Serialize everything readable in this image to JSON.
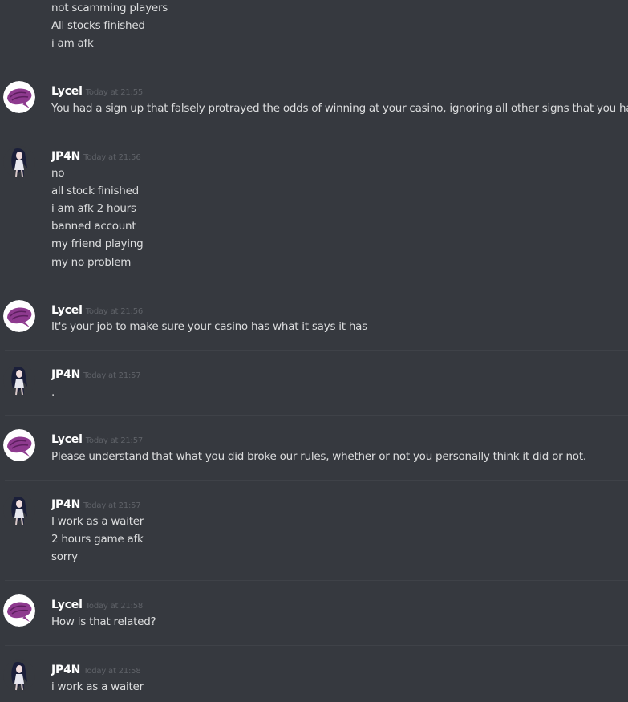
{
  "colors": {
    "background": "#36393f",
    "divider": "#3f4248",
    "username": "#ffffff",
    "timestamp": "#5f6268",
    "message_text": "#dcddde"
  },
  "top_continuation": {
    "lines": [
      "not scamming players",
      "All stocks finished",
      "i am afk"
    ]
  },
  "messages": [
    {
      "author": "Lycel",
      "avatar_icon": "purple-bird-avatar-icon",
      "timestamp": "Today at 21:55",
      "lines": [
        "You had a sign up that falsely protrayed the odds of winning at your casino, ignoring all other signs that you had up."
      ]
    },
    {
      "author": "JP4N",
      "avatar_icon": "anime-character-avatar-icon",
      "timestamp": "Today at 21:56",
      "lines": [
        "no",
        "all stock finished",
        "i am afk 2 hours",
        "banned account",
        "my friend playing",
        "my no problem"
      ]
    },
    {
      "author": "Lycel",
      "avatar_icon": "purple-bird-avatar-icon",
      "timestamp": "Today at 21:56",
      "lines": [
        "It's your job to make sure your casino has what it says it has"
      ]
    },
    {
      "author": "JP4N",
      "avatar_icon": "anime-character-avatar-icon",
      "timestamp": "Today at 21:57",
      "lines": [
        "."
      ]
    },
    {
      "author": "Lycel",
      "avatar_icon": "purple-bird-avatar-icon",
      "timestamp": "Today at 21:57",
      "lines": [
        "Please understand that what you did broke our rules, whether or not you personally think it did or not."
      ]
    },
    {
      "author": "JP4N",
      "avatar_icon": "anime-character-avatar-icon",
      "timestamp": "Today at 21:57",
      "lines": [
        "I work as a waiter",
        "2 hours game afk",
        "sorry"
      ]
    },
    {
      "author": "Lycel",
      "avatar_icon": "purple-bird-avatar-icon",
      "timestamp": "Today at 21:58",
      "lines": [
        "How is that related?"
      ]
    },
    {
      "author": "JP4N",
      "avatar_icon": "anime-character-avatar-icon",
      "timestamp": "Today at 21:58",
      "lines": [
        "i work as a waiter"
      ]
    }
  ]
}
